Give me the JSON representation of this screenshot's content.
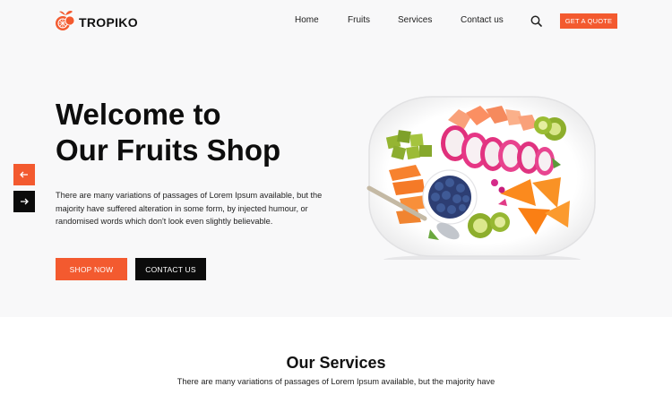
{
  "brand": {
    "name": "TROPIKO",
    "logo_icon": "orange-fruit-icon",
    "accent": "#f35a2f"
  },
  "nav": {
    "items": [
      {
        "label": "Home"
      },
      {
        "label": "Fruits"
      },
      {
        "label": "Services"
      },
      {
        "label": "Contact us"
      }
    ],
    "search_icon": "search-icon",
    "quote_label": "GET A QUOTE"
  },
  "hero": {
    "title_line1": "Welcome to",
    "title_line2": "Our Fruits Shop",
    "description": "There are many variations of passages of Lorem Ipsum available, but the majority have suffered alteration in some form, by injected humour, or randomised words which don't look even slightly believable.",
    "shop_label": "SHOP NOW",
    "contact_label": "CONTACT US",
    "prev_icon": "arrow-left-icon",
    "next_icon": "arrow-right-icon"
  },
  "services": {
    "title": "Our Services",
    "description": "There are many variations of passages of Lorem Ipsum available, but the majority have"
  }
}
